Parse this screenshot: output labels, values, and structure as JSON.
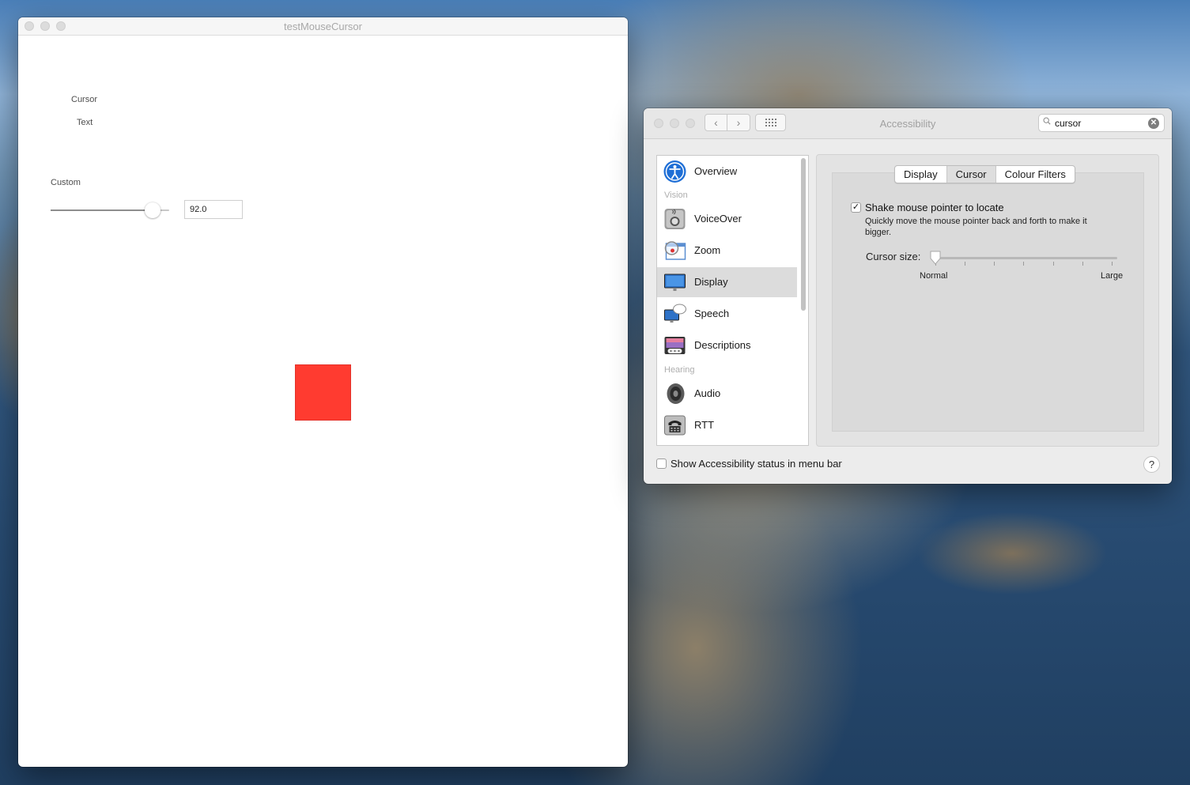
{
  "test_window": {
    "title": "testMouseCursor",
    "cursor_label": "Cursor",
    "text_label": "Text",
    "custom_label": "Custom",
    "slider_value": "92.0",
    "slider_fraction": 0.86,
    "square_color": "#ff3b30"
  },
  "accessibility_window": {
    "title": "Accessibility",
    "search": {
      "value": "cursor"
    },
    "sidebar": {
      "items": [
        {
          "label": "Overview",
          "icon": "accessibility-icon"
        },
        {
          "section": "Vision"
        },
        {
          "label": "VoiceOver",
          "icon": "voiceover-icon"
        },
        {
          "label": "Zoom",
          "icon": "zoom-icon"
        },
        {
          "label": "Display",
          "icon": "display-icon",
          "selected": true
        },
        {
          "label": "Speech",
          "icon": "speech-icon"
        },
        {
          "label": "Descriptions",
          "icon": "descriptions-icon"
        },
        {
          "section": "Hearing"
        },
        {
          "label": "Audio",
          "icon": "audio-icon"
        },
        {
          "label": "RTT",
          "icon": "rtt-icon"
        }
      ]
    },
    "tabs": [
      {
        "label": "Display"
      },
      {
        "label": "Cursor",
        "active": true
      },
      {
        "label": "Colour Filters"
      }
    ],
    "shake": {
      "label": "Shake mouse pointer to locate",
      "checked": true,
      "description": "Quickly move the mouse pointer back and forth to make it bigger."
    },
    "cursor_size": {
      "label": "Cursor size:",
      "min_label": "Normal",
      "max_label": "Large",
      "fraction": 0.0
    },
    "menu_bar_status": {
      "label": "Show Accessibility status in menu bar",
      "checked": false
    },
    "help_label": "?"
  }
}
